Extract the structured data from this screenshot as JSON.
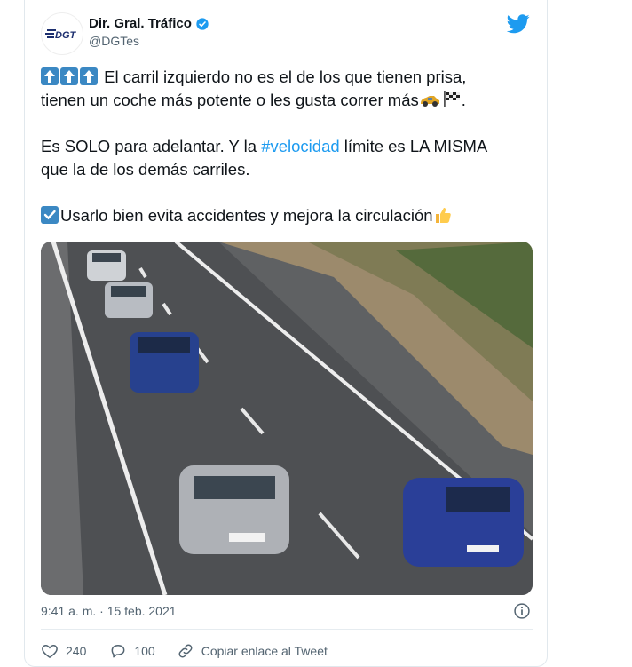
{
  "account": {
    "display_name": "Dir. Gral. Tráfico",
    "handle": "@DGTes",
    "avatar_text": "DGT",
    "brand_color": "#1d2f6f"
  },
  "tweet": {
    "line1": "El carril izquierdo no es el de los que tienen prisa,",
    "line2": "tienen un coche más potente o les gusta correr más",
    "line2_end": ".",
    "line3_pre": "Es SOLO para adelantar.  Y la ",
    "hashtag": "#velocidad",
    "line3_post": " límite es LA MISMA",
    "line4": "que la de los demás carriles.",
    "line5": "Usarlo bien evita accidentes y mejora la circulación",
    "emojis": [
      "up-arrow-icon",
      "up-arrow-icon",
      "up-arrow-icon",
      "racing-car-icon",
      "checkered-flag-icon",
      "check-box-icon",
      "thumbs-up-icon"
    ]
  },
  "meta": {
    "timestamp": "9:41 a. m. · 15 feb. 2021"
  },
  "actions": {
    "likes": "240",
    "replies": "100",
    "copy_link": "Copiar enlace al Tweet"
  },
  "colors": {
    "accent": "#1d9bf0",
    "text": "#0f1419",
    "secondary": "#536471"
  }
}
